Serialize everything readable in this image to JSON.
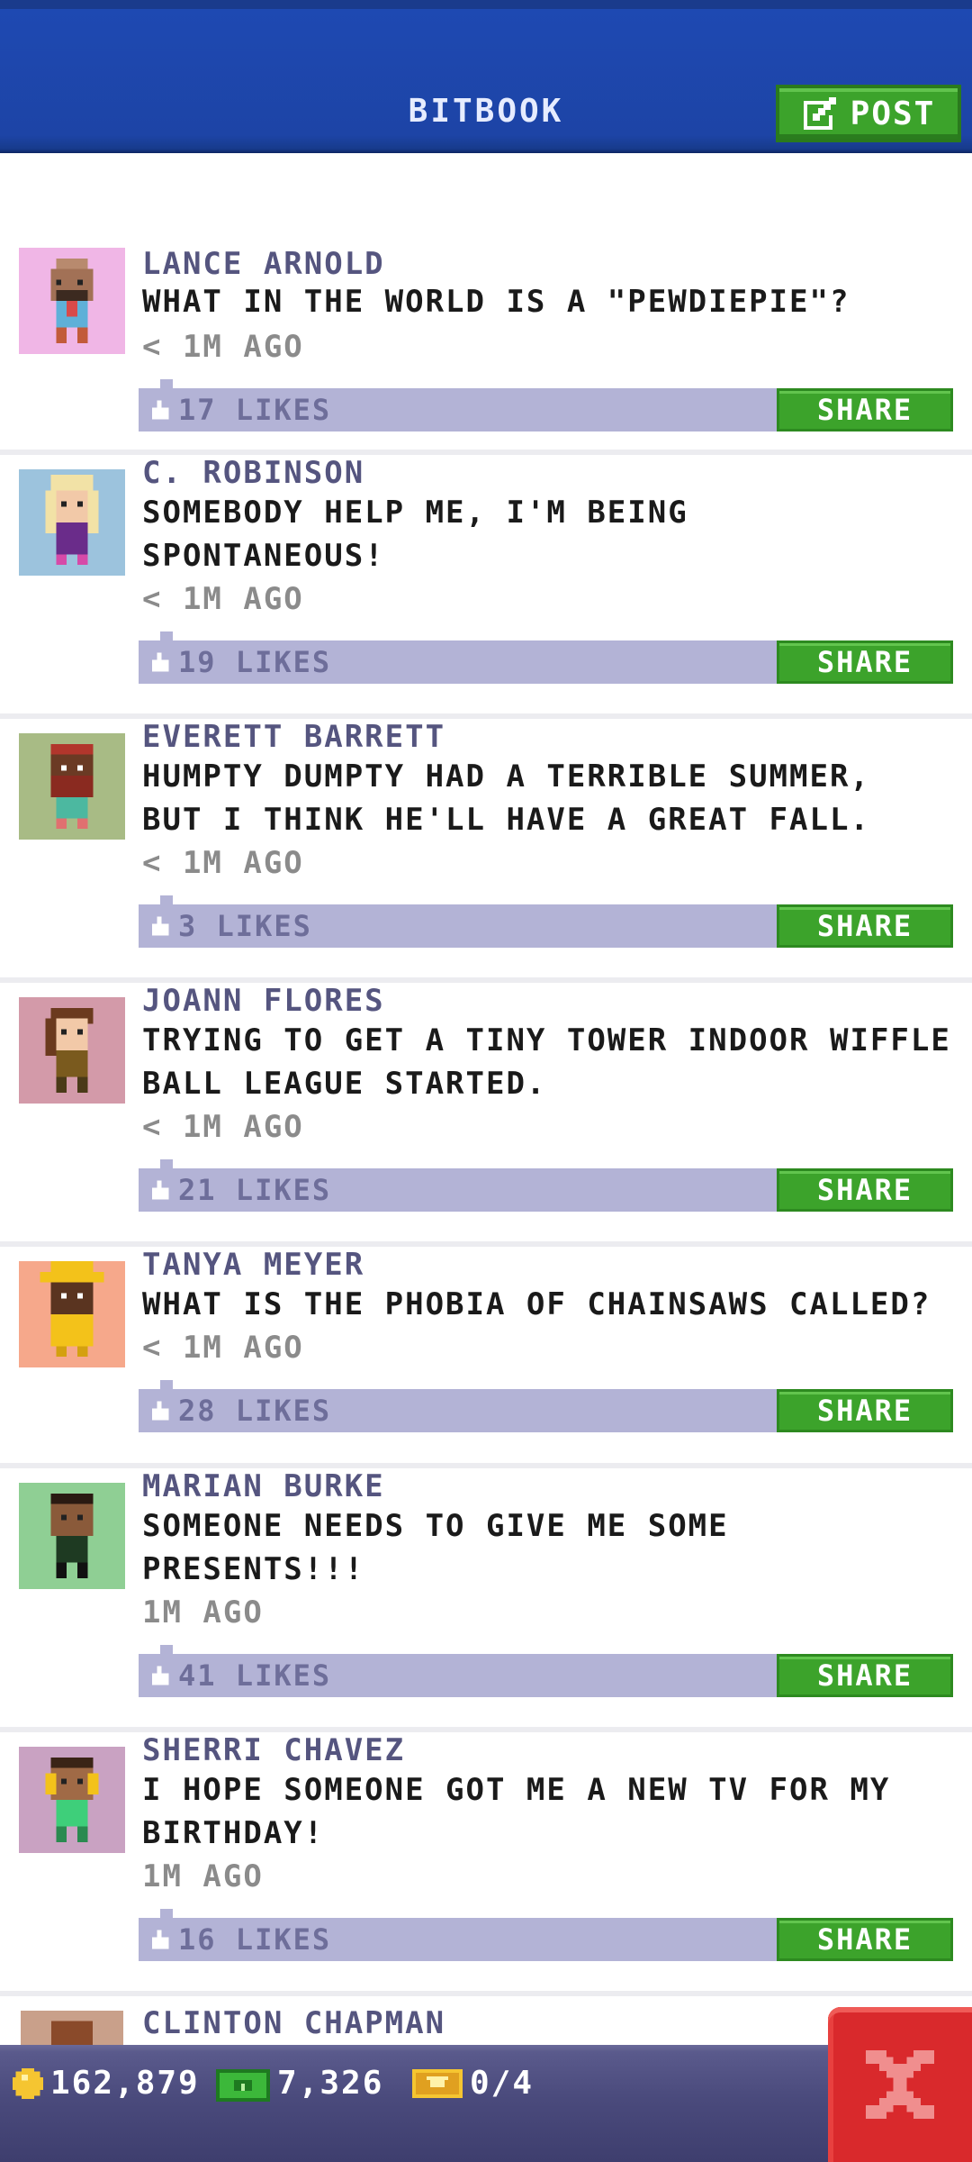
{
  "header": {
    "title": "BITBOOK",
    "post_label": "POST"
  },
  "posts": [
    {
      "author": "LANCE ARNOLD",
      "message": "WHAT IN THE WORLD IS A \"PEWDIEPIE\"?",
      "time": "< 1M AGO",
      "likes": "17 LIKES",
      "share": "SHARE",
      "avatar_bg": "#f0b6e6"
    },
    {
      "author": "C. ROBINSON",
      "message": "SOMEBODY HELP ME, I'M BEING\nSPONTANEOUS!",
      "time": "< 1M AGO",
      "likes": "19 LIKES",
      "share": "SHARE",
      "avatar_bg": "#9cc3dd"
    },
    {
      "author": "EVERETT BARRETT",
      "message": "HUMPTY DUMPTY HAD A TERRIBLE SUMMER,\nBUT I THINK HE'LL HAVE A GREAT FALL.",
      "time": "< 1M AGO",
      "likes": "3 LIKES",
      "share": "SHARE",
      "avatar_bg": "#a8bb85"
    },
    {
      "author": "JOANN FLORES",
      "message": "TRYING TO GET A TINY TOWER INDOOR WIFFLE\nBALL LEAGUE STARTED.",
      "time": "< 1M AGO",
      "likes": "21 LIKES",
      "share": "SHARE",
      "avatar_bg": "#d39aa9"
    },
    {
      "author": "TANYA MEYER",
      "message": "WHAT IS THE PHOBIA OF CHAINSAWS CALLED?",
      "time": "< 1M AGO",
      "likes": "28 LIKES",
      "share": "SHARE",
      "avatar_bg": "#f6a88b"
    },
    {
      "author": "MARIAN BURKE",
      "message": "SOMEONE NEEDS TO GIVE ME SOME\nPRESENTS!!!",
      "time": "1M AGO",
      "likes": "41 LIKES",
      "share": "SHARE",
      "avatar_bg": "#8fcf94"
    },
    {
      "author": "SHERRI CHAVEZ",
      "message": "I HOPE SOMEONE GOT ME A NEW TV FOR MY\nBIRTHDAY!",
      "time": "1M AGO",
      "likes": "16 LIKES",
      "share": "SHARE",
      "avatar_bg": "#c9a2c2"
    }
  ],
  "partial_post": {
    "author": "CLINTON CHAPMAN"
  },
  "footer": {
    "coins": "162,879",
    "bux": "7,326",
    "tickets": "0/4"
  },
  "icons": {
    "post": "edit-icon",
    "like": "thumb-up-icon",
    "coin": "coin-icon",
    "bux": "cash-icon",
    "ticket": "ticket-icon",
    "close": "close-icon"
  },
  "colors": {
    "header": "#1d44a6",
    "accent_green": "#3ca32b",
    "likes_bar": "#b3b3d6",
    "bottom_bar": "#4a4a7c",
    "close_red": "#d9292c"
  }
}
